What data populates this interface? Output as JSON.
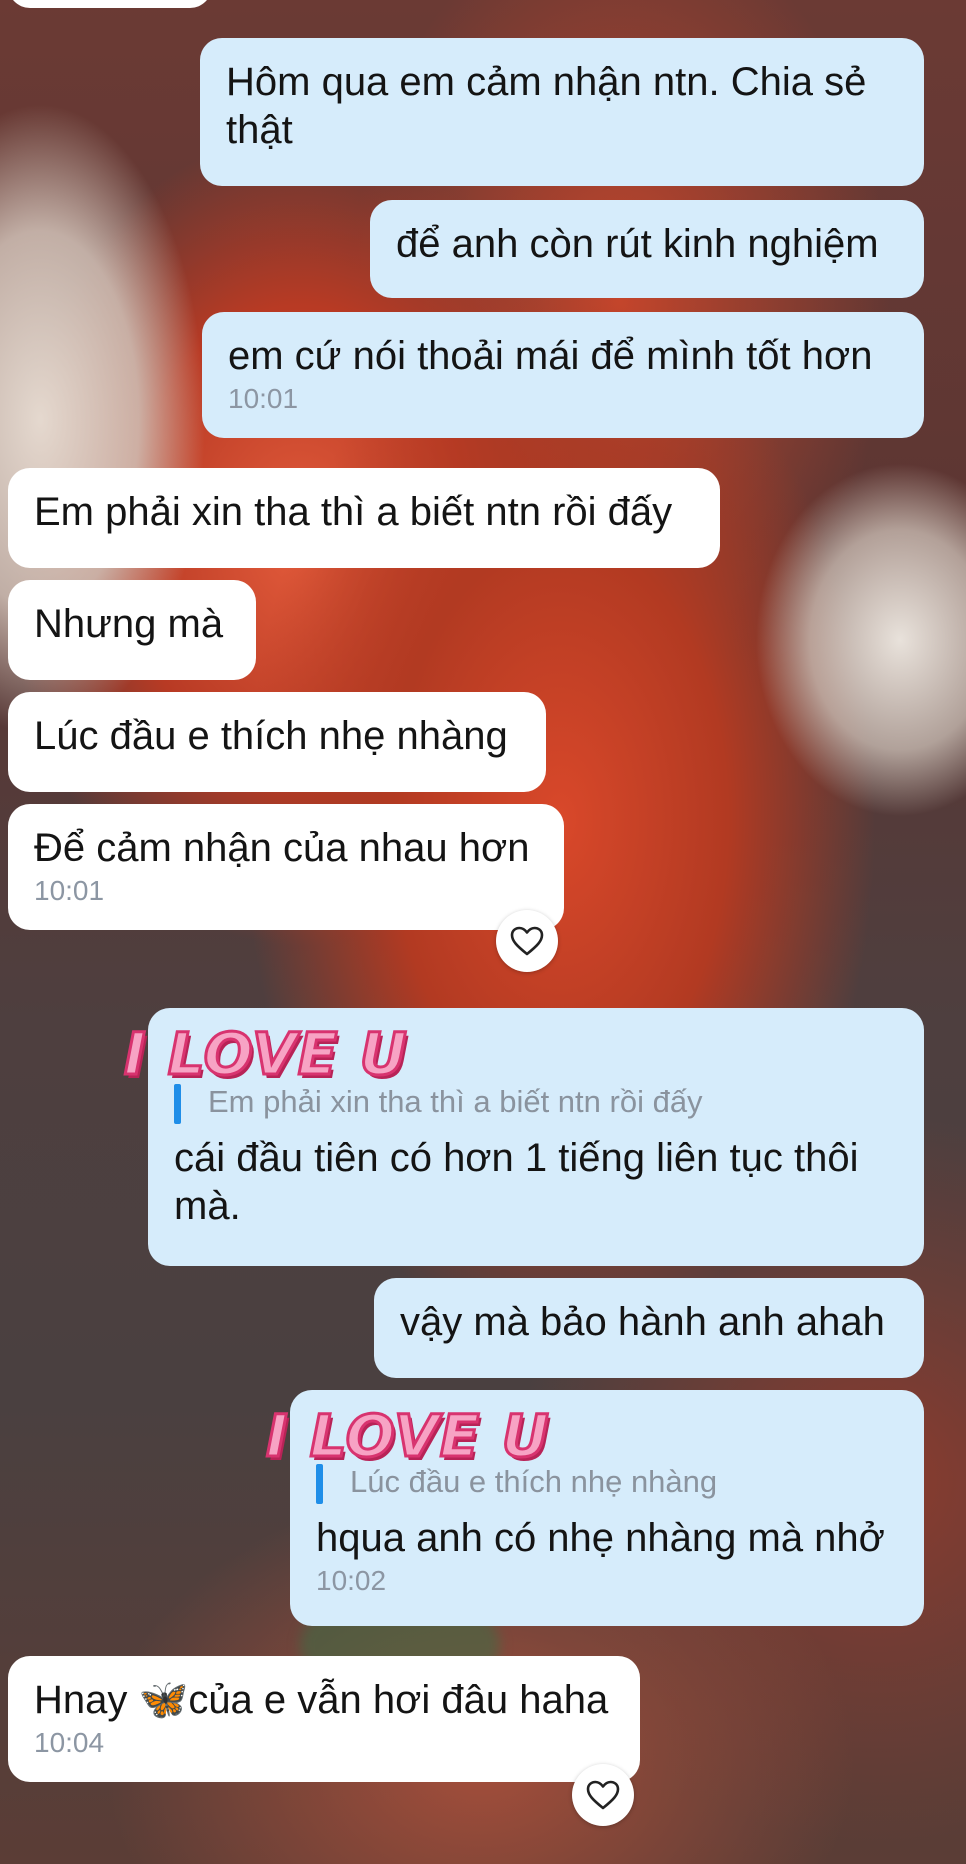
{
  "messages": {
    "m1": {
      "text": "Hôm qua em cảm nhận ntn. Chia sẻ thật"
    },
    "m2": {
      "text": "để anh còn rút kinh nghiệm"
    },
    "m3": {
      "text": "em cứ nói thoải mái để mình tốt hơn",
      "time": "10:01"
    },
    "m4": {
      "text": "Em phải xin tha thì a biết ntn rồi đấy"
    },
    "m5": {
      "text": "Nhưng mà"
    },
    "m6": {
      "text": "Lúc đầu e thích nhẹ nhàng"
    },
    "m7": {
      "text": "Để cảm nhận của nhau hơn",
      "time": "10:01"
    },
    "m8": {
      "sticker": "I LOVE U",
      "quote": "Em phải xin tha thì a biết ntn rồi đấy",
      "text": "cái đầu tiên có hơn 1 tiếng liên tục thôi mà."
    },
    "m9": {
      "text": "vậy mà bảo hành anh ahah"
    },
    "m10": {
      "sticker": "I LOVE U",
      "quote": "Lúc đầu e thích nhẹ nhàng",
      "text": "hqua anh có nhẹ nhàng mà nhở",
      "time": "10:02"
    },
    "m11": {
      "text_before": "Hnay ",
      "emoji": "🦋",
      "text_after": "của e vẫn hơi đâu haha",
      "time": "10:04"
    }
  },
  "colors": {
    "outgoing_bubble": "#d6ecfb",
    "incoming_bubble": "#ffffff",
    "quote_bar": "#1f8ee8",
    "timestamp": "#8c96a3"
  },
  "icons": {
    "reaction": "heart-outline-icon"
  }
}
